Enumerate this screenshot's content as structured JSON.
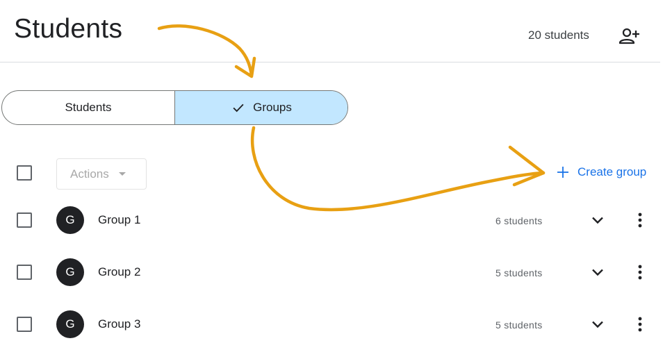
{
  "header": {
    "title": "Students",
    "student_count": "20 students",
    "add_icon": "person-add-icon"
  },
  "segmented": {
    "options": [
      {
        "label": "Students",
        "selected": false
      },
      {
        "label": "Groups",
        "selected": true
      }
    ]
  },
  "toolbar": {
    "actions_label": "Actions",
    "create_group_label": "Create group"
  },
  "groups": [
    {
      "avatar": "G",
      "name": "Group 1",
      "count": "6 students"
    },
    {
      "avatar": "G",
      "name": "Group 2",
      "count": "5 students"
    },
    {
      "avatar": "G",
      "name": "Group 3",
      "count": "5 students"
    }
  ],
  "colors": {
    "accent": "#1a73e8",
    "selected_segment": "#c2e7ff",
    "annotation_arrow": "#e8a013",
    "avatar_bg": "#202124"
  }
}
